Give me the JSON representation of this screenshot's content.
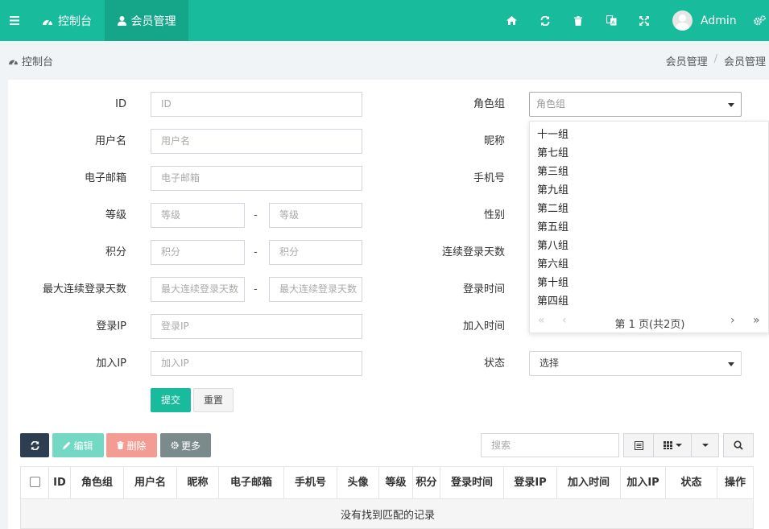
{
  "navbar": {
    "tabs": [
      {
        "label": "控制台",
        "icon": "dashboard-icon"
      },
      {
        "label": "会员管理",
        "icon": "user-icon"
      }
    ],
    "user_name": "Admin"
  },
  "breadcrumb": {
    "page_title": "控制台",
    "items": [
      "会员管理",
      "会员管理"
    ]
  },
  "form": {
    "left": [
      {
        "label": "ID",
        "placeholder": "ID"
      },
      {
        "label": "用户名",
        "placeholder": "用户名"
      },
      {
        "label": "电子邮箱",
        "placeholder": "电子邮箱"
      },
      {
        "label": "等级",
        "placeholder_from": "等级",
        "placeholder_to": "等级"
      },
      {
        "label": "积分",
        "placeholder_from": "积分",
        "placeholder_to": "积分"
      },
      {
        "label": "最大连续登录天数",
        "placeholder_from": "最大连续登录天数",
        "placeholder_to": "最大连续登录天数"
      },
      {
        "label": "登录IP",
        "placeholder": "登录IP"
      },
      {
        "label": "加入IP",
        "placeholder": "加入IP"
      }
    ],
    "right_labels": [
      "角色组",
      "昵称",
      "手机号",
      "性别",
      "连续登录天数",
      "登录时间",
      "加入时间",
      "状态"
    ],
    "range_separator": "-",
    "group_select_placeholder": "角色组",
    "status_select_value": "选择",
    "submit_label": "提交",
    "reset_label": "重置"
  },
  "dropdown": {
    "options": [
      "十一组",
      "第七组",
      "第三组",
      "第九组",
      "第二组",
      "第五组",
      "第八组",
      "第六组",
      "第十组",
      "第四组"
    ],
    "pager_text": "第 1 页(共2页)"
  },
  "toolbar": {
    "edit_label": "编辑",
    "delete_label": "删除",
    "more_label": "更多",
    "search_placeholder": "搜索"
  },
  "table": {
    "columns": [
      "ID",
      "角色组",
      "用户名",
      "昵称",
      "电子邮箱",
      "手机号",
      "头像",
      "等级",
      "积分",
      "登录时间",
      "登录IP",
      "加入时间",
      "加入IP",
      "状态",
      "操作"
    ],
    "empty_text": "没有找到匹配的记录"
  },
  "colors": {
    "brand": "#18bc9c",
    "brand_dark": "#15a589",
    "refresh_btn": "#2c3e50",
    "edit_btn": "#74d9c4",
    "delete_btn": "#f39c93",
    "more_btn": "#7b8a8b"
  }
}
